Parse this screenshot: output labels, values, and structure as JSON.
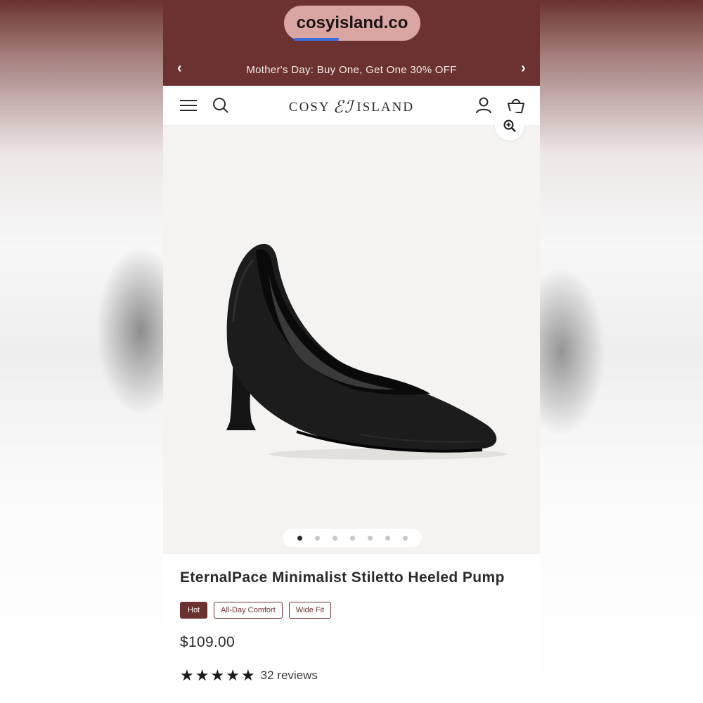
{
  "browser": {
    "url": "cosyisland.co"
  },
  "announcement": {
    "text": "Mother's Day: Buy One, Get One 30% OFF",
    "prev_icon": "chevron-left-icon",
    "next_icon": "chevron-right-icon"
  },
  "header": {
    "logo_left": "COSY",
    "logo_mark": "ℰℐ",
    "logo_right": "ISLAND",
    "icons": [
      "menu-icon",
      "search-icon",
      "account-icon",
      "cart-icon"
    ]
  },
  "gallery": {
    "image_count": 7,
    "active_index": 0,
    "zoom_icon": "zoom-in-icon"
  },
  "product": {
    "title": "EternalPace Minimalist Stiletto Heeled Pump",
    "badges": [
      "Hot",
      "All-Day Comfort",
      "Wide Fit"
    ],
    "price": "$109.00",
    "rating": 5,
    "reviews": "32 reviews"
  },
  "colors": {
    "brand": "#6b3231",
    "pill": "#d9a6a4",
    "gallery_bg": "#f4f3f1"
  }
}
